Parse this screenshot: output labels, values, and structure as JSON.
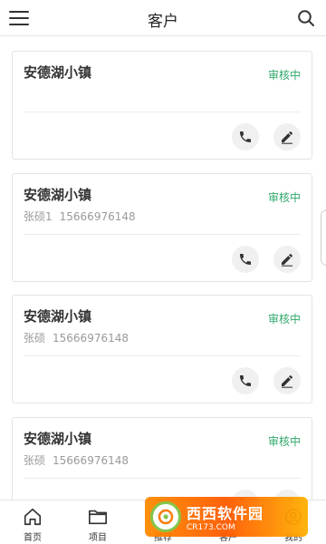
{
  "header": {
    "title": "客户",
    "menu_icon": "menu-icon",
    "search_icon": "search-icon"
  },
  "customers": [
    {
      "name": "安德湖小镇",
      "status": "审核中",
      "contact_name": "",
      "phone": ""
    },
    {
      "name": "安德湖小镇",
      "status": "审核中",
      "contact_name": "张硕1",
      "phone": "15666976148"
    },
    {
      "name": "安德湖小镇",
      "status": "审核中",
      "contact_name": "张硕",
      "phone": "15666976148"
    },
    {
      "name": "安德湖小镇",
      "status": "审核中",
      "contact_name": "张硕",
      "phone": "15666976148"
    }
  ],
  "tabs": [
    {
      "label": "首页",
      "icon": "home-icon"
    },
    {
      "label": "项目",
      "icon": "folder-icon"
    },
    {
      "label": "推荐",
      "icon": "recommend-icon"
    },
    {
      "label": "客户",
      "icon": "customer-icon",
      "active": true
    },
    {
      "label": "我的",
      "icon": "profile-icon"
    }
  ],
  "watermark": {
    "text": "西西软件园",
    "url": "CR173.COM"
  },
  "colors": {
    "status_green": "#2fa869",
    "button_bg": "#f0f0f0",
    "border": "#e4e4e4"
  }
}
